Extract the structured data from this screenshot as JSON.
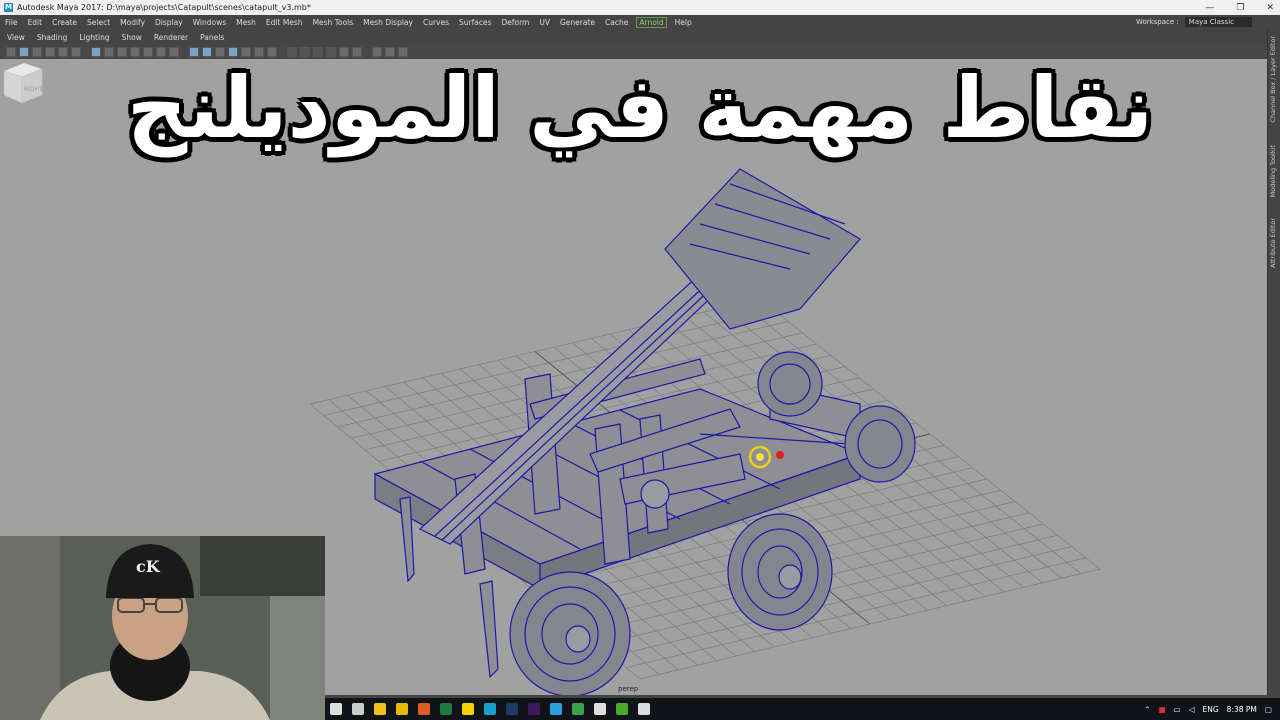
{
  "window": {
    "title": "Autodesk Maya 2017: D:\\maya\\projects\\Catapult\\scenes\\catapult_v3.mb*",
    "controls": [
      "—",
      "❐",
      "✕"
    ]
  },
  "menubar": {
    "items": [
      "File",
      "Edit",
      "Create",
      "Select",
      "Modify",
      "Display",
      "Windows",
      "Mesh",
      "Edit Mesh",
      "Mesh Tools",
      "Mesh Display",
      "Curves",
      "Surfaces",
      "Deform",
      "UV",
      "Generate",
      "Cache"
    ],
    "arnold": "Arnold",
    "help": "Help",
    "workspace_label": "Workspace :",
    "workspace_value": "Maya Classic"
  },
  "panel_menu": [
    "View",
    "Shading",
    "Lighting",
    "Show",
    "Renderer",
    "Panels"
  ],
  "right_tabs": [
    "Channel Box / Layer Editor",
    "Modeling Toolkit",
    "Attribute Editor"
  ],
  "viewport": {
    "camera_label": "perep",
    "viewcube_label": "RIGHT"
  },
  "overlay": {
    "title": "نقاط مهمة في الموديلنج"
  },
  "webcam": {
    "cap_text": "cK"
  },
  "taskbar": {
    "tray_lang": "ENG",
    "tray_time": "8:38 PM"
  },
  "colors": {
    "viewport_bg": "#a1a1a1",
    "wire": "#1a1aa8",
    "grid": "#7c7c7c",
    "ui_dark": "#444444"
  }
}
